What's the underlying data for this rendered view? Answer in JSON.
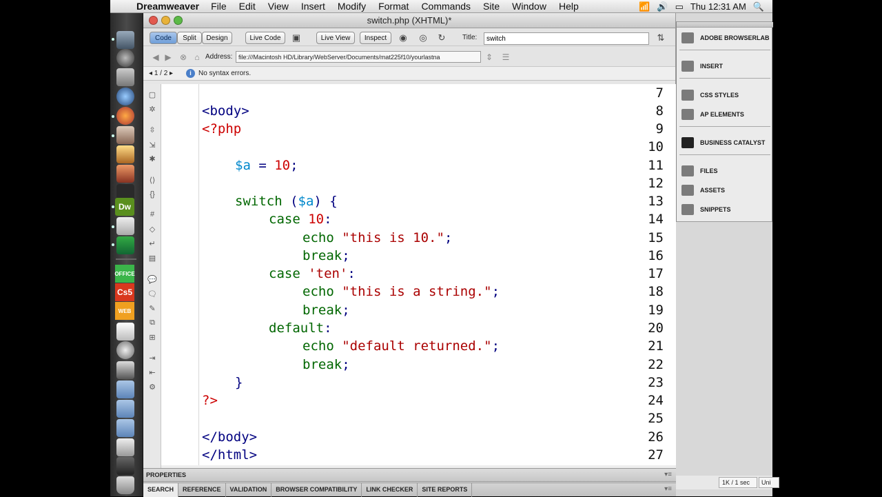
{
  "menubar": {
    "app": "Dreamweaver",
    "items": [
      "File",
      "Edit",
      "View",
      "Insert",
      "Modify",
      "Format",
      "Commands",
      "Site",
      "Window",
      "Help"
    ],
    "clock": "Thu 12:31 AM"
  },
  "dock": {
    "labels": [
      "Dw",
      "OFFICE",
      "Cs5",
      "WEB"
    ]
  },
  "window": {
    "title": "switch.php (XHTML)*"
  },
  "toolbar": {
    "code": "Code",
    "split": "Split",
    "design": "Design",
    "live_code": "Live Code",
    "live_view": "Live View",
    "inspect": "Inspect",
    "title_label": "Title:",
    "title_value": "switch"
  },
  "address": {
    "label": "Address:",
    "value": "file:///Macintosh HD/Library/WebServer/Documents/mat225f10/yourlastna"
  },
  "info": {
    "page": "1 / 2",
    "message": "No syntax errors."
  },
  "code": {
    "line_numbers": [
      "7",
      "8",
      "9",
      "10",
      "11",
      "12",
      "13",
      "14",
      "15",
      "16",
      "17",
      "18",
      "19",
      "20",
      "21",
      "22",
      "23",
      "24",
      "25",
      "26",
      "27"
    ],
    "t_body": "<body>",
    "t_php_open": "<?php",
    "t_var": "$a",
    "t_eq": " = ",
    "t_ten": "10",
    "t_semi": ";",
    "t_switch": "switch",
    "t_paren_open": " (",
    "t_paren_close": ") {",
    "t_case": "case",
    "t_colon": ":",
    "t_echo": "echo",
    "t_str1": "\"this is 10.\"",
    "t_break": "break",
    "t_str_ten": "'ten'",
    "t_str2": "\"this is a string.\"",
    "t_default": "default",
    "t_str3": "\"default returned.\"",
    "t_close_brace": "}",
    "t_php_close": "?>",
    "t_body_close": "</body>",
    "t_html_close": "</html>"
  },
  "panels": {
    "items": [
      "ADOBE BROWSERLAB",
      "INSERT",
      "CSS STYLES",
      "AP ELEMENTS",
      "BUSINESS CATALYST",
      "FILES",
      "ASSETS",
      "SNIPPETS"
    ]
  },
  "bottom": {
    "properties": "PROPERTIES",
    "tabs": [
      "SEARCH",
      "REFERENCE",
      "VALIDATION",
      "BROWSER COMPATIBILITY",
      "LINK CHECKER",
      "SITE REPORTS"
    ],
    "status_size": "1K / 1 sec",
    "status_enc": "Uni"
  },
  "colors": {
    "tag": "#000080",
    "php_delim": "#cc0000",
    "variable": "#0088cc",
    "number": "#cc0000",
    "keyword": "#006600",
    "string": "#aa0000"
  }
}
